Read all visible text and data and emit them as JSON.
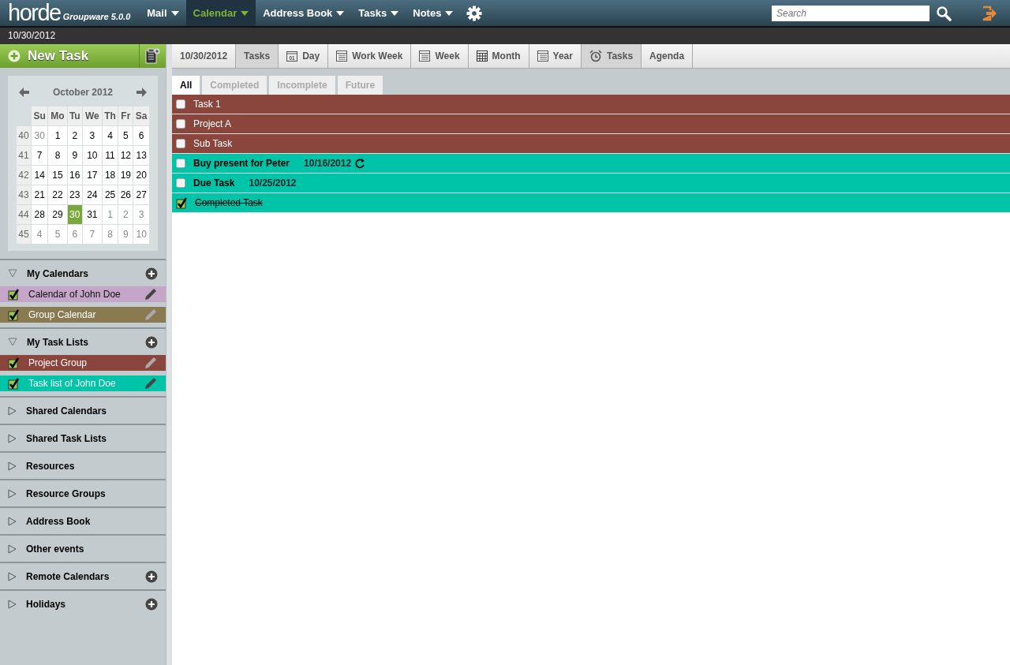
{
  "header": {
    "logo": "horde",
    "version": "Groupware 5.0.0",
    "menu": [
      {
        "label": "Mail",
        "selected": false
      },
      {
        "label": "Calendar",
        "selected": true
      },
      {
        "label": "Address Book",
        "selected": false
      },
      {
        "label": "Tasks",
        "selected": false
      },
      {
        "label": "Notes",
        "selected": false
      }
    ],
    "search": {
      "placeholder": "Search"
    }
  },
  "date_bar": "10/30/2012",
  "sidebar": {
    "new_task": "New Task",
    "mini_calendar": {
      "title": "October 2012",
      "weekdays": [
        "Su",
        "Mo",
        "Tu",
        "We",
        "Th",
        "Fr",
        "Sa"
      ],
      "weeks": [
        {
          "number": "40",
          "days": [
            {
              "label": "30",
              "other_month": true,
              "selected": false
            },
            {
              "label": "1",
              "other_month": false,
              "selected": false
            },
            {
              "label": "2",
              "other_month": false,
              "selected": false
            },
            {
              "label": "3",
              "other_month": false,
              "selected": false
            },
            {
              "label": "4",
              "other_month": false,
              "selected": false
            },
            {
              "label": "5",
              "other_month": false,
              "selected": false
            },
            {
              "label": "6",
              "other_month": false,
              "selected": false
            }
          ]
        },
        {
          "number": "41",
          "days": [
            {
              "label": "7",
              "other_month": false,
              "selected": false
            },
            {
              "label": "8",
              "other_month": false,
              "selected": false
            },
            {
              "label": "9",
              "other_month": false,
              "selected": false
            },
            {
              "label": "10",
              "other_month": false,
              "selected": false
            },
            {
              "label": "11",
              "other_month": false,
              "selected": false
            },
            {
              "label": "12",
              "other_month": false,
              "selected": false
            },
            {
              "label": "13",
              "other_month": false,
              "selected": false
            }
          ]
        },
        {
          "number": "42",
          "days": [
            {
              "label": "14",
              "other_month": false,
              "selected": false
            },
            {
              "label": "15",
              "other_month": false,
              "selected": false
            },
            {
              "label": "16",
              "other_month": false,
              "selected": false
            },
            {
              "label": "17",
              "other_month": false,
              "selected": false
            },
            {
              "label": "18",
              "other_month": false,
              "selected": false
            },
            {
              "label": "19",
              "other_month": false,
              "selected": false
            },
            {
              "label": "20",
              "other_month": false,
              "selected": false
            }
          ]
        },
        {
          "number": "43",
          "days": [
            {
              "label": "21",
              "other_month": false,
              "selected": false
            },
            {
              "label": "22",
              "other_month": false,
              "selected": false
            },
            {
              "label": "23",
              "other_month": false,
              "selected": false
            },
            {
              "label": "24",
              "other_month": false,
              "selected": false
            },
            {
              "label": "25",
              "other_month": false,
              "selected": false
            },
            {
              "label": "26",
              "other_month": false,
              "selected": false
            },
            {
              "label": "27",
              "other_month": false,
              "selected": false
            }
          ]
        },
        {
          "number": "44",
          "days": [
            {
              "label": "28",
              "other_month": false,
              "selected": false
            },
            {
              "label": "29",
              "other_month": false,
              "selected": false
            },
            {
              "label": "30",
              "other_month": false,
              "selected": true
            },
            {
              "label": "31",
              "other_month": false,
              "selected": false
            },
            {
              "label": "1",
              "other_month": true,
              "selected": false
            },
            {
              "label": "2",
              "other_month": true,
              "selected": false
            },
            {
              "label": "3",
              "other_month": true,
              "selected": false
            }
          ]
        },
        {
          "number": "45",
          "days": [
            {
              "label": "4",
              "other_month": true,
              "selected": false
            },
            {
              "label": "5",
              "other_month": true,
              "selected": false
            },
            {
              "label": "6",
              "other_month": true,
              "selected": false
            },
            {
              "label": "7",
              "other_month": true,
              "selected": false
            },
            {
              "label": "8",
              "other_month": true,
              "selected": false
            },
            {
              "label": "9",
              "other_month": true,
              "selected": false
            },
            {
              "label": "10",
              "other_month": true,
              "selected": false
            }
          ]
        }
      ]
    },
    "sections": [
      {
        "title": "My Calendars",
        "expanded": true,
        "can_add": true,
        "items": [
          {
            "label": "Calendar of John Doe",
            "color": "#c5a5c8",
            "checked": true,
            "editable": true
          },
          {
            "label": "Group Calendar",
            "color": "#8a7a52",
            "checked": true,
            "editable": false
          }
        ]
      },
      {
        "title": "My Task Lists",
        "expanded": true,
        "can_add": true,
        "items": [
          {
            "label": "Project Group",
            "color": "#8a463c",
            "checked": true,
            "editable": false
          },
          {
            "label": "Task list of John Doe",
            "color": "#00c4a8",
            "checked": true,
            "editable": true
          }
        ]
      },
      {
        "title": "Shared Calendars",
        "expanded": false,
        "can_add": false
      },
      {
        "title": "Shared Task Lists",
        "expanded": false,
        "can_add": false
      },
      {
        "title": "Resources",
        "expanded": false,
        "can_add": false
      },
      {
        "title": "Resource Groups",
        "expanded": false,
        "can_add": false
      },
      {
        "title": "Address Book",
        "expanded": false,
        "can_add": false
      },
      {
        "title": "Other events",
        "expanded": false,
        "can_add": false
      },
      {
        "title": "Remote Calendars",
        "expanded": false,
        "can_add": true
      },
      {
        "title": "Holidays",
        "expanded": false,
        "can_add": true
      }
    ]
  },
  "view_tabs": [
    {
      "label": "10/30/2012",
      "kind": "plain",
      "selected": false
    },
    {
      "label": "Tasks",
      "kind": "plain",
      "selected": true
    },
    {
      "label": "Day",
      "kind": "day",
      "selected": false
    },
    {
      "label": "Work Week",
      "kind": "list",
      "selected": false
    },
    {
      "label": "Week",
      "kind": "list",
      "selected": false
    },
    {
      "label": "Month",
      "kind": "grid",
      "selected": false
    },
    {
      "label": "Year",
      "kind": "list",
      "selected": false
    },
    {
      "label": "Tasks",
      "kind": "alarm",
      "selected": true
    },
    {
      "label": "Agenda",
      "kind": "plain",
      "selected": false
    }
  ],
  "day_icon_text": "01",
  "filter_tabs": [
    {
      "label": "All",
      "selected": true
    },
    {
      "label": "Completed",
      "selected": false
    },
    {
      "label": "Incomplete",
      "selected": false
    },
    {
      "label": "Future",
      "selected": false
    }
  ],
  "tasks": [
    {
      "name": "Task 1",
      "recurring": false,
      "checked": false,
      "color": "#8a463c",
      "emphasized": false
    },
    {
      "name": "Project A",
      "recurring": false,
      "checked": false,
      "color": "#8a463c",
      "emphasized": false
    },
    {
      "name": "Sub Task",
      "recurring": false,
      "checked": false,
      "color": "#8a463c",
      "emphasized": false
    },
    {
      "name": "Buy present for Peter",
      "due": "10/16/2012",
      "recurring": true,
      "checked": false,
      "color": "#00c4a8",
      "emphasized": true
    },
    {
      "name": "Due Task",
      "due": "10/25/2012",
      "recurring": false,
      "checked": false,
      "color": "#00c4a8",
      "emphasized": true
    },
    {
      "name": "Completed Task",
      "recurring": false,
      "checked": true,
      "color": "#00c4a8",
      "emphasized": false
    }
  ]
}
